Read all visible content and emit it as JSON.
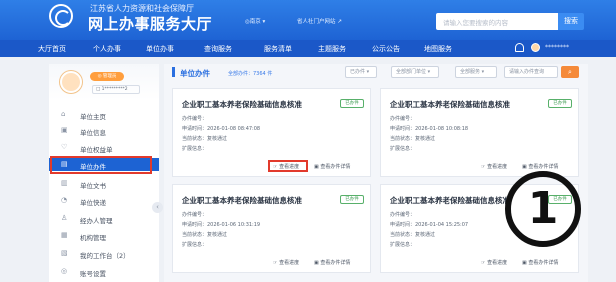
{
  "header": {
    "org_name": "江苏省人力资源和社会保障厅",
    "title": "网上办事服务大厅",
    "location": "◎南京 ▾",
    "portal_link": "省人社门户网站 ↗",
    "search_placeholder": "请输入您要搜索的内容",
    "search_button": "搜索",
    "user_name": "********"
  },
  "nav": {
    "items": [
      "大厅首页",
      "个人办事",
      "单位办事",
      "查询服务",
      "服务清单",
      "主题服务",
      "公示公告",
      "地图服务"
    ]
  },
  "sidebar": {
    "badge": "◎ 管理员",
    "account_id": "□ 1*********2",
    "items": [
      {
        "icon": "⌂",
        "label": "单位主页"
      },
      {
        "icon": "▣",
        "label": "单位信息"
      },
      {
        "icon": "♡",
        "label": "单位权益单"
      },
      {
        "icon": "▤",
        "label": "单位办件"
      },
      {
        "icon": "▥",
        "label": "单位文书"
      },
      {
        "icon": "◔",
        "label": "单位快递"
      },
      {
        "icon": "♙",
        "label": "经办人管理"
      },
      {
        "icon": "▦",
        "label": "机构管理"
      },
      {
        "icon": "▧",
        "label": "我的工作台（2）"
      },
      {
        "icon": "◎",
        "label": "账号设置"
      }
    ],
    "collapse": "‹"
  },
  "main": {
    "section_title": "单位办件",
    "count_text": "全部办件：7364 件",
    "filters": [
      "已办件 ▾",
      "全部部门单位 ▾",
      "全部服务 ▾",
      "请输入办件查询"
    ],
    "filter_button": "⌕",
    "cards": [
      {
        "title": "企业职工基本养老保险基础信息核准",
        "tag": "已办件",
        "no": "办件编号：",
        "time": "申请时间：2026-01-08 08:47:08",
        "status": "当前状态：复核通过",
        "ext": "扩展信息：",
        "act1": "☞ 查看进度",
        "act2": "▣ 查看办件详情"
      },
      {
        "title": "企业职工基本养老保险基础信息核准",
        "tag": "已办件",
        "no": "办件编号：",
        "time": "申请时间：2026-01-08 10:08:18",
        "status": "当前状态：复核通过",
        "ext": "扩展信息：",
        "act1": "☞ 查看进度",
        "act2": "▣ 查看办件详情"
      },
      {
        "title": "企业职工基本养老保险基础信息核准",
        "tag": "已办件",
        "no": "办件编号：",
        "time": "申请时间：2026-01-06 10:31:19",
        "status": "当前状态：复核通过",
        "ext": "扩展信息：",
        "act1": "☞ 查看进度",
        "act2": "▣ 查看办件详情"
      },
      {
        "title": "企业职工基本养老保险基础信息核准",
        "tag": "已办件",
        "no": "办件编号：",
        "time": "申请时间：2026-01-04 15:25:07",
        "status": "当前状态：复核通过",
        "ext": "扩展信息：",
        "act1": "☞ 查看进度",
        "act2": "▣ 查看办件详情"
      }
    ]
  },
  "annotation": {
    "number": "1"
  },
  "colors": {
    "brand": "#1e63d4",
    "highlight": "#e23a2c",
    "tag": "#3d9c52",
    "accent": "#f58a3a"
  }
}
